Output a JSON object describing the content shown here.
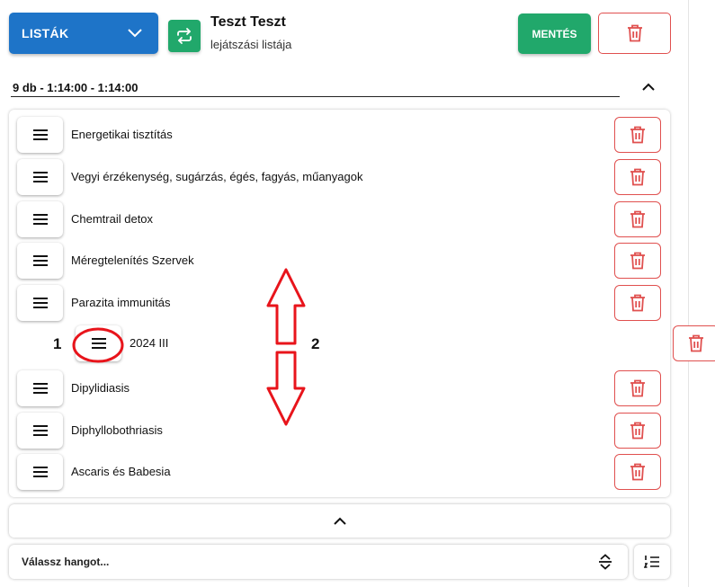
{
  "header": {
    "lists_label": "LISTÁK",
    "title": "Teszt Teszt",
    "subtitle": "lejátszási listája",
    "save_label": "MENTÉS"
  },
  "summary": "9 db - 1:14:00 - 1:14:00",
  "items": [
    {
      "label": "Energetikai tisztítás"
    },
    {
      "label": "Vegyi érzékenység, sugárzás, égés, fagyás, műanyagok"
    },
    {
      "label": "Chemtrail detox"
    },
    {
      "label": "Méregtelenítés Szervek"
    },
    {
      "label": "Parazita immunitás"
    },
    {
      "label": "2024 III",
      "dragging": true
    },
    {
      "label": "Dipylidiasis"
    },
    {
      "label": "Diphyllobothriasis"
    },
    {
      "label": "Ascaris és Babesia"
    }
  ],
  "annotations": {
    "marker_1": "1",
    "marker_2": "2"
  },
  "footer": {
    "sound_placeholder": "Válassz hangot..."
  },
  "colors": {
    "primary_blue": "#1e74c8",
    "green": "#21a86b",
    "danger_red": "#e0504f",
    "annotation_red": "#e8141b"
  },
  "icons": {
    "lists": "chevron-down-icon",
    "swap": "swap-arrows-icon",
    "delete": "trash-icon",
    "handle": "drag-handle-icon",
    "collapse": "chevron-up-icon",
    "select": "unfold-icon",
    "queue": "list-numbered-icon"
  }
}
